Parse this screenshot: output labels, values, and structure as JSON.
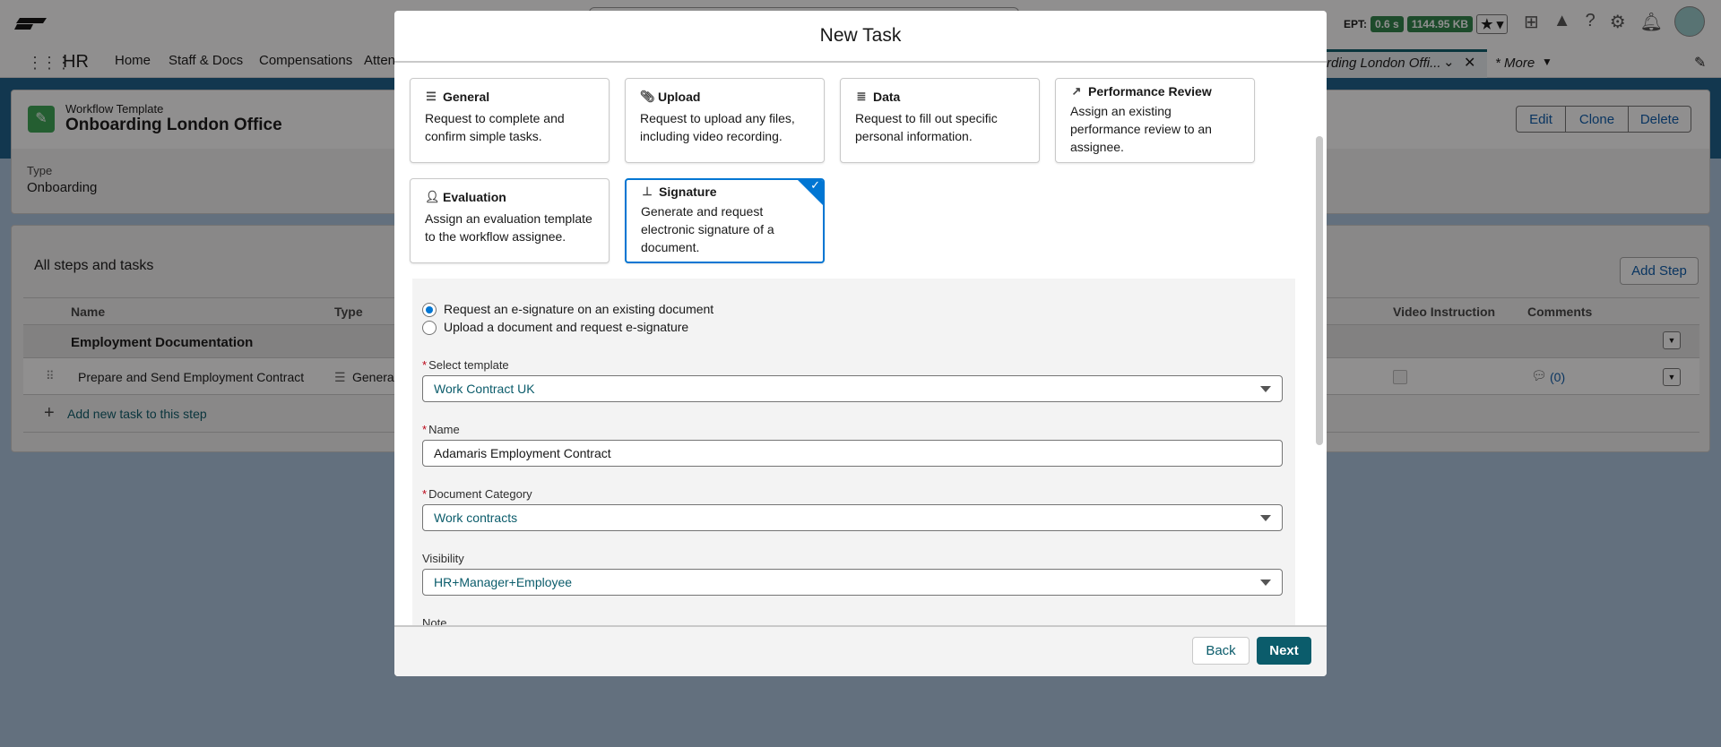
{
  "topbar": {
    "ept_label": "EPT:",
    "ept_time": "0.6 s",
    "ept_size": "1144.95 KB"
  },
  "nav": {
    "app": "HR",
    "items": [
      "Home",
      "Staff & Docs",
      "Compensations",
      "Atten"
    ],
    "open_tab": "rding London Offi...",
    "more": "* More"
  },
  "record": {
    "object": "Workflow Template",
    "title": "Onboarding London Office",
    "type_label": "Type",
    "type_value": "Onboarding",
    "actions": [
      "Edit",
      "Clone",
      "Delete"
    ]
  },
  "steps": {
    "title": "All steps and tasks",
    "add_step": "Add Step",
    "columns": {
      "name": "Name",
      "type": "Type",
      "video": "Video Instruction",
      "comments": "Comments"
    },
    "step_name": "Employment Documentation",
    "task_name": "Prepare and Send Employment Contract",
    "task_type": "General",
    "comments_count": "(0)",
    "add_task": "Add new task to this step"
  },
  "modal": {
    "title": "New Task",
    "task_types": [
      {
        "title": "General",
        "desc": "Request to complete and confirm simple tasks.",
        "icon": "checklist-icon"
      },
      {
        "title": "Upload",
        "desc": "Request to upload any files, including video recording.",
        "icon": "paperclip-icon"
      },
      {
        "title": "Data",
        "desc": "Request to fill out specific personal information.",
        "icon": "database-icon"
      },
      {
        "title": "Performance Review",
        "desc": "Assign an existing performance review to an assignee.",
        "icon": "trend-icon"
      },
      {
        "title": "Evaluation",
        "desc": "Assign an evaluation template to the workflow assignee.",
        "icon": "person-icon"
      },
      {
        "title": "Signature",
        "desc": "Generate and request electronic signature of a document.",
        "icon": "stamp-icon",
        "selected": true
      }
    ],
    "radio_options": [
      {
        "label": "Request an e-signature on an existing document",
        "checked": true
      },
      {
        "label": "Upload a document and request e-signature",
        "checked": false
      }
    ],
    "fields": {
      "template": {
        "label": "Select template",
        "value": "Work Contract UK"
      },
      "name": {
        "label": "Name",
        "value": "Adamaris Employment Contract"
      },
      "category": {
        "label": "Document Category",
        "value": "Work contracts"
      },
      "visibility": {
        "label": "Visibility",
        "value": "HR+Manager+Employee"
      },
      "note": {
        "label": "Note"
      }
    },
    "back": "Back",
    "next": "Next"
  },
  "colors": {
    "brand": "#0b5c6b",
    "selected": "#0176d3",
    "ept_badge": "#2e844a"
  }
}
